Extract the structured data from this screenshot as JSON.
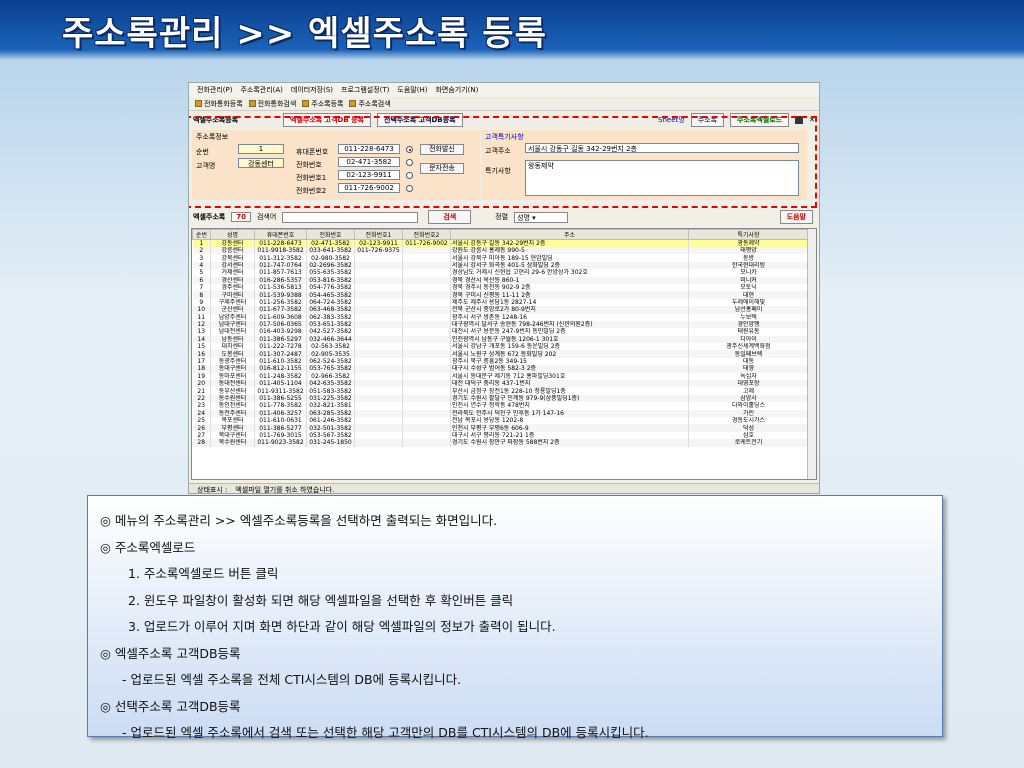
{
  "slide_title": "주소록관리 >> 엑셀주소록 등록",
  "menu": [
    "전화관리(P)",
    "주소록관리(A)",
    "데이터저장(S)",
    "프로그램설정(T)",
    "도움말(H)",
    "화면숨기기(N)"
  ],
  "toolbar": [
    "전화통화등록",
    "전화통화검색",
    "주소록등록",
    "주소록검색"
  ],
  "form": {
    "title": "엑셀주소록등록",
    "btn_excel_db": "엑셀주소록 고객DB 등록",
    "btn_select_db": "선택주소록 고객DB등록",
    "sheet_label": "Sheet명",
    "sheet_value": "주소록",
    "btn_upload": "주소록엑셀로드"
  },
  "info": {
    "title": "주소록정보",
    "seq_label": "순번",
    "seq_value": "1",
    "name_label": "고객명",
    "name_value": "강동센터",
    "mobile_label": "휴대폰번호",
    "mobile_value": "011-228-6473",
    "phone_label": "전화번호",
    "phone_value": "02-471-3582",
    "phone1_label": "전화번호1",
    "phone1_value": "02-123-9911",
    "phone2_label": "전화번호2",
    "phone2_value": "011-726-9002",
    "btn_call": "전화발신",
    "btn_sms": "문자전송"
  },
  "cust": {
    "title": "고객특기사항",
    "addr_label": "고객주소",
    "addr_value": "서울시 강동구 길동 342-29번지 2층",
    "note_label": "특기사항",
    "note_value": "왕동제약"
  },
  "search": {
    "label": "엑셀주소록",
    "count": "70",
    "search_label": "검색어",
    "btn_search": "검색",
    "sort_label": "정렬",
    "sort_value": "성명",
    "btn_help": "도움말"
  },
  "grid": {
    "columns": [
      "순번",
      "성명",
      "휴대폰번호",
      "전화번호",
      "전화번호1",
      "전화번호2",
      "주소",
      "특기사항"
    ],
    "rows": [
      [
        "1",
        "강동센터",
        "011-228-6473",
        "02-471-3582",
        "02-123-9911",
        "011-726-9002",
        "서울시 강동구 길동 342-29번지 2층",
        "광동제약"
      ],
      [
        "2",
        "강릉센터",
        "011-9918-3582",
        "033-641-3582",
        "011-726-9375",
        "",
        "강원도 강릉시 홍제동 990-5",
        "태평양"
      ],
      [
        "3",
        "강북센터",
        "011-312-3582",
        "02-980-3582",
        "",
        "",
        "서울시 강북구 미아동 189-15 현암빌딩",
        "동방"
      ],
      [
        "4",
        "강서센터",
        "011-747-0764",
        "02-2696-3582",
        "",
        "",
        "서울시 강서구 화곡동 401-5 삼화빌딩 2층",
        "한국현대리빙"
      ],
      [
        "5",
        "거제센터",
        "011-857-7613",
        "055-635-3582",
        "",
        "",
        "경상남도 거제시 신현읍 고현리 29-6 한양상가 302호",
        "모니카"
      ],
      [
        "6",
        "경산센터",
        "016-286-5357",
        "053-816-3582",
        "",
        "",
        "경북 경산시 옥산동 860-1",
        "미니커"
      ],
      [
        "7",
        "경주센터",
        "011-536-5813",
        "054-776-3582",
        "",
        "",
        "경북 경주시 동천동 902-9 2층",
        "모토닉"
      ],
      [
        "8",
        "구미센터",
        "011-539-9388",
        "054-465-3582",
        "",
        "",
        "경북 구미시 신평동 11-11 2층",
        "대현"
      ],
      [
        "9",
        "구제주센터",
        "011-256-3582",
        "064-724-3582",
        "",
        "",
        "제주도 제주시 용담1동 2827-14",
        "두레에이해빛"
      ],
      [
        "10",
        "군산센터",
        "011-677-3582",
        "063-468-3582",
        "",
        "",
        "전북 군산시 중앙로2가 80-9번지",
        "남선홍페이"
      ],
      [
        "11",
        "남양주센터",
        "011-609-3608",
        "062-383-3582",
        "",
        "",
        "광주시 서구 쌍촌동 1248-16",
        "누보텍"
      ],
      [
        "12",
        "남대구센터",
        "017-506-0365",
        "053-651-3582",
        "",
        "",
        "대구광역시 달서구 송현동 798-246번지 (신한의원2층)",
        "경인양행"
      ],
      [
        "13",
        "남대전센터",
        "016-403-9298",
        "042-527-3582",
        "",
        "",
        "대전시 서구 용문동 247-9번지 동민빌딩 2층",
        "태원유통"
      ],
      [
        "14",
        "남동센터",
        "011-386-5297",
        "032-466-3644",
        "",
        "",
        "인천광역시 남동구 구월동 1206-1 301호",
        "디아이"
      ],
      [
        "15",
        "대치센터",
        "011-222-7278",
        "02-563-3582",
        "",
        "",
        "서울시 강남구 개포동 159-6 통운빌딩 2층",
        "광주신세계백화점"
      ],
      [
        "16",
        "도봉센터",
        "011-307-2487",
        "02-905-3535",
        "",
        "",
        "서울시 노원구 상계동 672 동화빌딩 202",
        "동일페브렉"
      ],
      [
        "17",
        "동광주센터",
        "011-610-3582",
        "062-524-3582",
        "",
        "",
        "광주시 북구 중흥2동 349-15",
        "대동"
      ],
      [
        "18",
        "동대구센터",
        "016-812-1155",
        "053-765-3582",
        "",
        "",
        "대구시 수성구 범어동 582-3 2층",
        "태영"
      ],
      [
        "19",
        "동마포센터",
        "011-248-3582",
        "02-966-3582",
        "",
        "",
        "서울시 동대문구 제기동 712 홍파빌딩301호",
        "녹십자"
      ],
      [
        "20",
        "동대전센터",
        "011-405-1104",
        "042-635-3582",
        "",
        "",
        "대전 대덕구 중리동 437-1번지",
        "대영포장"
      ],
      [
        "21",
        "동부산센터",
        "011-9311-3582",
        "051-583-3582",
        "",
        "",
        "부산시 금정구 장전1동 228-10 청룡빌딩1층",
        "고제"
      ],
      [
        "22",
        "동수원센터",
        "011-386-5255",
        "031-225-3582",
        "",
        "",
        "경기도 수원시 팔달구 인계동 979-9(삼풍빌딩1층)",
        "삼양사"
      ],
      [
        "23",
        "동인천센터",
        "011-778-3582",
        "032-821-3581",
        "",
        "",
        "인천시 연수구 청학동 478번지",
        "다와이홀딩스"
      ],
      [
        "24",
        "동전주센터",
        "011-406-3257",
        "063-285-3582",
        "",
        "",
        "전라북도 전주시 덕진구 인후동 1가 147-16",
        "가린"
      ],
      [
        "25",
        "목포센터",
        "011-610-0631",
        "061-246-3582",
        "",
        "",
        "전남 목포시 용당동 1202-8",
        "경동도시가스"
      ],
      [
        "26",
        "부평센터",
        "011-386-5277",
        "032-501-3582",
        "",
        "",
        "인천시 부평구 부평6동 606-9",
        "덕성"
      ],
      [
        "27",
        "북대구센터",
        "011-769-3015",
        "053-567-3582",
        "",
        "",
        "대구시 서구 평리동 721-21 1층",
        "삼호"
      ],
      [
        "28",
        "북수원센터",
        "011-9023-3582",
        "031-245-1850",
        "",
        "",
        "경기도 수원시 장안구 파장동 588번지 2층",
        "로케트전기"
      ]
    ]
  },
  "status": {
    "label": "상태표시 :",
    "message": "엑셀파일 열기를 취소 하였습니다."
  },
  "notes": [
    "◎ 메뉴의 주소록관리 >> 엑셀주소록등록을 선택하면 출력되는 화면입니다.",
    "◎ 주소록엑셀로드",
    "1. 주소록엑셀로드 버튼 클릭",
    "2. 윈도우 파일창이 활성화 되면 해당 엑셀파일을 선택한 후 확인버튼 클릭",
    "3. 업로드가 이루어 지며 화면 하단과 같이 해당 엑셀파일의 정보가 출력이 됩니다.",
    "◎ 엑셀주소록 고객DB등록",
    "- 업로드된 엑셀 주소록을 전체 CTI시스템의 DB에 등록시킵니다.",
    "◎ 선택주소록 고객DB등록",
    "- 업로드된 엑셀 주소록에서 검색 또는 선택한 해당 고객만의 DB를 CTI시스템의 DB에 등록시킵니다."
  ]
}
